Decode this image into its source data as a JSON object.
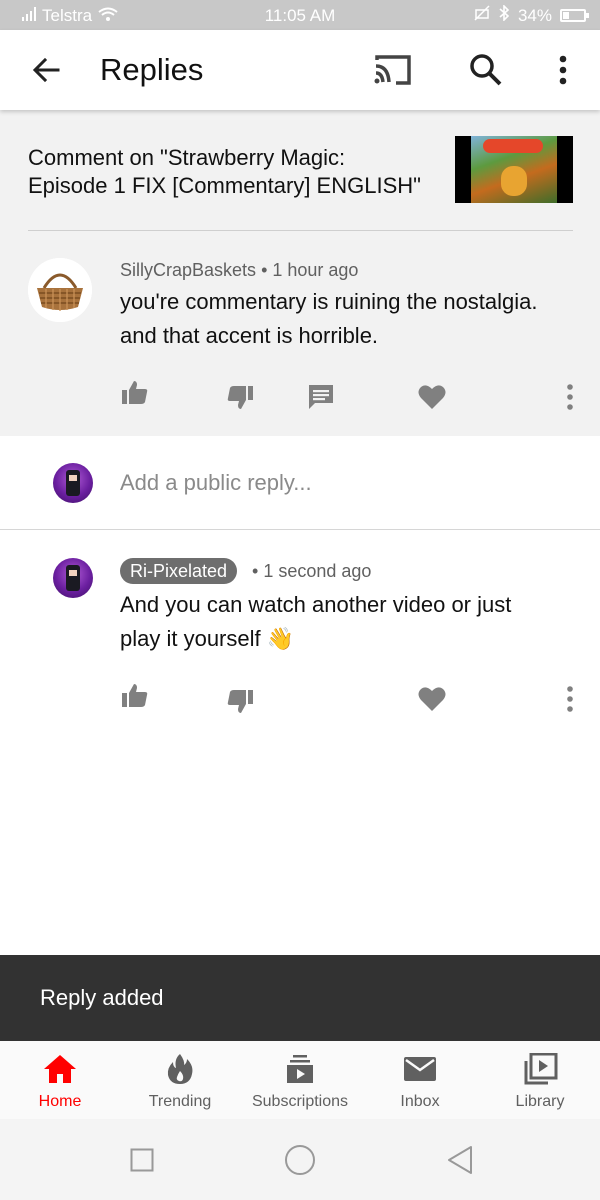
{
  "status_bar": {
    "carrier": "Telstra",
    "time": "11:05 AM",
    "battery": "34%"
  },
  "app_bar": {
    "title": "Replies",
    "icons": [
      "back-arrow-icon",
      "cast-icon",
      "search-icon",
      "more-vert-icon"
    ]
  },
  "parent_comment": {
    "context_line1": "Comment on \"Strawberry Magic:",
    "context_line2": "Episode 1 FIX [Commentary] ENGLISH\"",
    "author": "SillyCrapBaskets",
    "time": "1 hour ago",
    "text_line1": "you're commentary is ruining the nostalgia.",
    "text_line2": "and that accent is horrible.",
    "actions": [
      "like-icon",
      "dislike-icon",
      "reply-icon",
      "heart-icon",
      "more-vert-icon"
    ]
  },
  "reply_input": {
    "placeholder": "Add a public reply..."
  },
  "reply": {
    "author": "Ri-Pixelated",
    "time": "1 second ago",
    "text_line1": "And you can watch another video or just",
    "text_line2": "play it yourself",
    "emoji": "👋",
    "actions": [
      "like-icon",
      "dislike-icon",
      "heart-icon",
      "more-vert-icon"
    ]
  },
  "snackbar": {
    "message": "Reply added"
  },
  "bottom_nav": {
    "items": [
      {
        "label": "Home",
        "icon": "home-icon",
        "active": true
      },
      {
        "label": "Trending",
        "icon": "flame-icon",
        "active": false
      },
      {
        "label": "Subscriptions",
        "icon": "subscriptions-icon",
        "active": false
      },
      {
        "label": "Inbox",
        "icon": "mail-icon",
        "active": false
      },
      {
        "label": "Library",
        "icon": "library-icon",
        "active": false
      }
    ]
  },
  "colors": {
    "accent_active": "#ff0000",
    "icon_gray": "#808080",
    "snackbar_bg": "#323232",
    "status_bar_bg": "#c8c8c8"
  }
}
